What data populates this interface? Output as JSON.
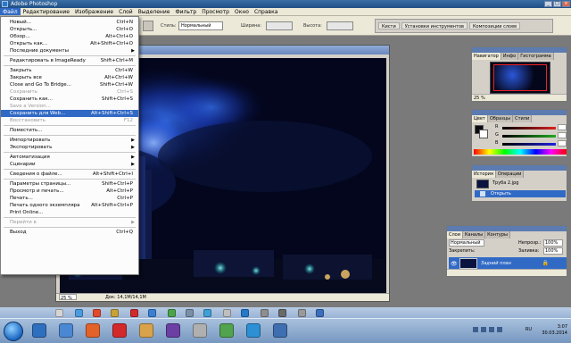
{
  "window": {
    "title": "Adobe Photoshop"
  },
  "menubar": {
    "items": [
      "Файл",
      "Редактирование",
      "Изображение",
      "Слой",
      "Выделение",
      "Фильтр",
      "Просмотр",
      "Окно",
      "Справка"
    ]
  },
  "optionsbar": {
    "style_label": "Стиль:",
    "style_value": "Нормальный",
    "width_label": "Ширина:",
    "height_label": "Высота:",
    "palette_well": [
      "Кисти",
      "Установки инструментов",
      "Композиции слоев"
    ]
  },
  "file_menu": {
    "items": [
      {
        "label": "Новый...",
        "shortcut": "Ctrl+N"
      },
      {
        "label": "Открыть...",
        "shortcut": "Ctrl+O"
      },
      {
        "label": "Обзор...",
        "shortcut": "Alt+Ctrl+O"
      },
      {
        "label": "Открыть как...",
        "shortcut": "Alt+Shift+Ctrl+O"
      },
      {
        "label": "Последние документы",
        "shortcut": "",
        "submenu": true
      },
      {
        "sep": true
      },
      {
        "label": "Редактировать в ImageReady",
        "shortcut": "Shift+Ctrl+M"
      },
      {
        "sep": true
      },
      {
        "label": "Закрыть",
        "shortcut": "Ctrl+W"
      },
      {
        "label": "Закрыть все",
        "shortcut": "Alt+Ctrl+W"
      },
      {
        "label": "Close and Go To Bridge...",
        "shortcut": "Shift+Ctrl+W"
      },
      {
        "label": "Сохранить",
        "shortcut": "Ctrl+S",
        "disabled": true
      },
      {
        "label": "Сохранить как...",
        "shortcut": "Shift+Ctrl+S"
      },
      {
        "label": "Save a Version...",
        "shortcut": "",
        "disabled": true
      },
      {
        "label": "Сохранить для Web...",
        "shortcut": "Alt+Shift+Ctrl+S",
        "highlighted": true
      },
      {
        "label": "Восстановить",
        "shortcut": "F12",
        "disabled": true
      },
      {
        "sep": true
      },
      {
        "label": "Поместить...",
        "shortcut": ""
      },
      {
        "sep": true
      },
      {
        "label": "Импортировать",
        "shortcut": "",
        "submenu": true
      },
      {
        "label": "Экспортировать",
        "shortcut": "",
        "submenu": true
      },
      {
        "sep": true
      },
      {
        "label": "Автоматизация",
        "shortcut": "",
        "submenu": true
      },
      {
        "label": "Сценарии",
        "shortcut": "",
        "submenu": true
      },
      {
        "sep": true
      },
      {
        "label": "Сведения о файле...",
        "shortcut": "Alt+Shift+Ctrl+I"
      },
      {
        "sep": true
      },
      {
        "label": "Параметры страницы...",
        "shortcut": "Shift+Ctrl+P"
      },
      {
        "label": "Просмотр и печать...",
        "shortcut": "Alt+Ctrl+P"
      },
      {
        "label": "Печать...",
        "shortcut": "Ctrl+P"
      },
      {
        "label": "Печать одного экземпляра",
        "shortcut": "Alt+Shift+Ctrl+P"
      },
      {
        "label": "Print Online...",
        "shortcut": ""
      },
      {
        "sep": true
      },
      {
        "label": "Перейти в",
        "shortcut": "",
        "submenu": true,
        "disabled": true
      },
      {
        "sep": true
      },
      {
        "label": "Выход",
        "shortcut": "Ctrl+Q"
      }
    ]
  },
  "document": {
    "zoom": "25 %",
    "doc_info": "Док: 14,1M/14,1M"
  },
  "navigator": {
    "tabs": [
      "Навигатор",
      "Инфо",
      "Гистограмма"
    ],
    "zoom": "25 %"
  },
  "color_panel": {
    "tabs": [
      "Цвет",
      "Образцы",
      "Стили"
    ],
    "channels": [
      "R",
      "G",
      "B"
    ]
  },
  "history": {
    "tabs": [
      "История",
      "Операции"
    ],
    "snapshot": "Труба 2.jpg",
    "step": "Открыть"
  },
  "layers": {
    "tabs": [
      "Слои",
      "Каналы",
      "Контуры"
    ],
    "blend_mode": "Нормальный",
    "opacity_label": "Непрозр.:",
    "opacity": "100%",
    "fill_label": "Заливка:",
    "fill": "100%",
    "lock_label": "Закрепить:",
    "layer_name": "Задний план"
  },
  "taskbar": {
    "time": "3:07",
    "date": "30.03.2014",
    "lang": "RU",
    "mini_clock": "3:07\n30.03.2014"
  },
  "colors": {
    "accent": "#316ac5",
    "menu_bg": "#ece9d8",
    "title_bar": "#1f4f86"
  }
}
